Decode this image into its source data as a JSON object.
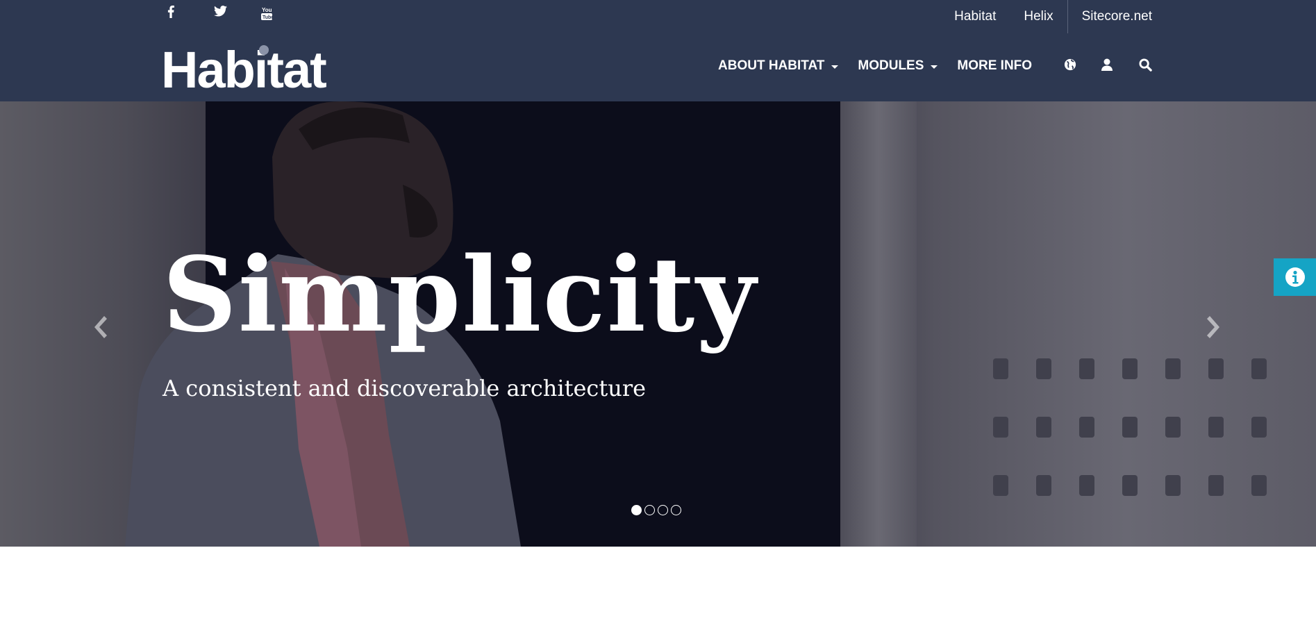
{
  "top_links": [
    {
      "label": "Habitat"
    },
    {
      "label": "Helix"
    },
    {
      "label": "Sitecore.net"
    }
  ],
  "social": [
    {
      "icon": "facebook-icon"
    },
    {
      "icon": "twitter-icon"
    },
    {
      "icon": "youtube-icon"
    }
  ],
  "logo": {
    "text": "Habitat"
  },
  "nav": {
    "items": [
      {
        "label": "ABOUT HABITAT",
        "has_dropdown": true
      },
      {
        "label": "MODULES",
        "has_dropdown": true
      },
      {
        "label": "MORE INFO",
        "has_dropdown": false
      }
    ],
    "icons": [
      "globe-icon",
      "user-icon",
      "search-icon"
    ]
  },
  "hero": {
    "title": "Simplicity",
    "subtitle": "A consistent and discoverable architecture",
    "slide_count": 4,
    "active_slide": 1
  },
  "colors": {
    "header_bg": "#2d3851",
    "info_tab": "#15a4c5"
  }
}
